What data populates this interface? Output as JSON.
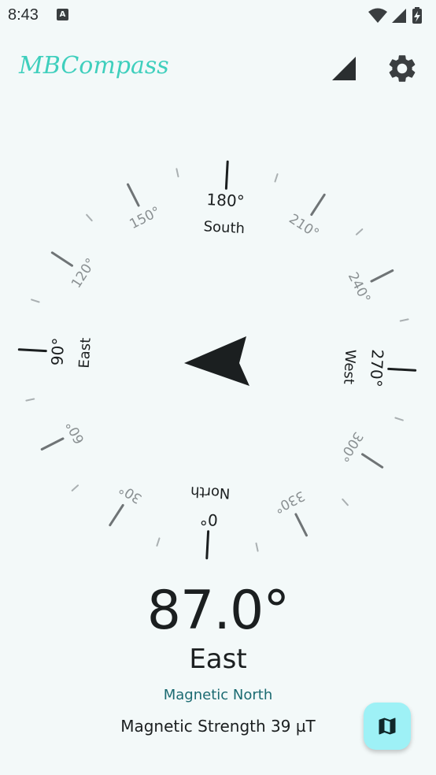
{
  "status_bar": {
    "time": "8:43",
    "notification_icon": "A",
    "icons": [
      "wifi-icon",
      "cell-signal-icon",
      "battery-charging-icon"
    ]
  },
  "app_bar": {
    "title": "MBCompass",
    "actions": [
      "signal-strength-icon",
      "gear-icon"
    ]
  },
  "compass": {
    "heading_degrees": 87.0,
    "cardinals": {
      "north": "North",
      "east": "East",
      "south": "South",
      "west": "West"
    },
    "degree_labels": [
      "0°",
      "30°",
      "60°",
      "90°",
      "120°",
      "150°",
      "180°",
      "210°",
      "240°",
      "270°",
      "300°",
      "330°"
    ],
    "pointer_icon": "navigation-arrow-icon"
  },
  "readout": {
    "heading": "87.0°",
    "direction": "East",
    "north_type": "Magnetic North",
    "magnetic_strength": "Magnetic Strength 39 µT"
  },
  "fab": {
    "icon": "map-icon"
  },
  "colors": {
    "background": "#f3f9f9",
    "title_accent": "#3fcfbd",
    "north_type_text": "#1c6b72",
    "fab_background": "#9ef1f6"
  }
}
